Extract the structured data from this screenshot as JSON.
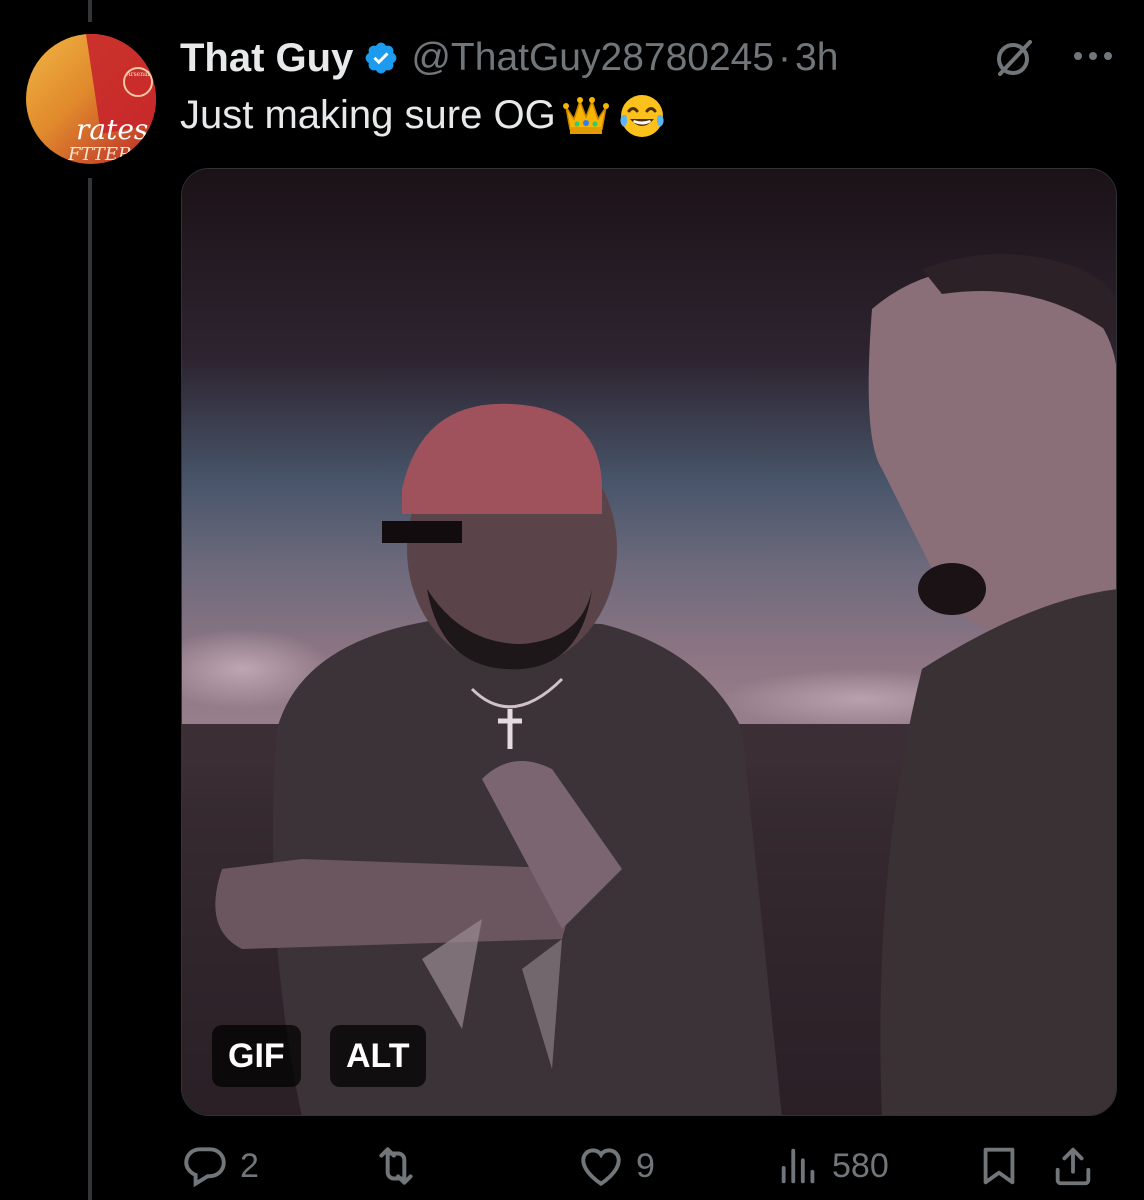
{
  "tweet": {
    "display_name": "That Guy",
    "verified": true,
    "handle": "@ThatGuy28780245",
    "separator": "·",
    "time": "3h",
    "text": "Just making sure OG",
    "emojis": [
      "crown",
      "face-with-tears-of-joy"
    ],
    "avatar": {
      "crest_text": "Arsenal",
      "text_line1": "rates",
      "text_line2": "FTTER"
    }
  },
  "media": {
    "type": "gif",
    "gif_badge": "GIF",
    "alt_badge": "ALT"
  },
  "actions": {
    "reply_count": "2",
    "repost_count": "",
    "like_count": "9",
    "views_count": "580"
  },
  "icons": {
    "verified": "verified-badge-icon",
    "grok": "grok-icon",
    "more": "more-icon",
    "reply": "reply-icon",
    "repost": "repost-icon",
    "like": "heart-icon",
    "views": "views-icon",
    "bookmark": "bookmark-icon",
    "share": "share-icon"
  },
  "colors": {
    "background": "#000000",
    "text_primary": "#e7e9ea",
    "text_secondary": "#71767b",
    "verified_blue": "#1d9bf0",
    "thread_line": "#333639"
  }
}
